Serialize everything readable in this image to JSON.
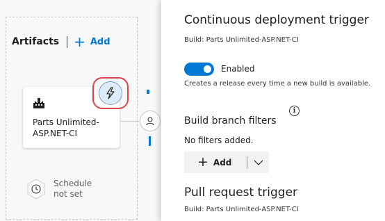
{
  "artifacts": {
    "title": "Artifacts",
    "add_label": "Add",
    "card": {
      "name": "Parts Unlimited-ASP.NET-CI",
      "icon": "build-pipeline-icon"
    },
    "trigger_icon": "lightning-trigger-icon",
    "approver_icon": "person-icon"
  },
  "schedule": {
    "label_line1": "Schedule",
    "label_line2": "not set",
    "icon": "clock-icon"
  },
  "panel": {
    "cd_trigger": {
      "title": "Continuous deployment trigger",
      "subtitle": "Build: Parts Unlimited-ASP.NET-CI",
      "toggle_label": "Enabled",
      "toggle_on": true,
      "description": "Creates a release every time a new build is available."
    },
    "branch_filters": {
      "title": "Build branch filters",
      "empty_text": "No filters added.",
      "add_label": "Add"
    },
    "pr_trigger": {
      "title": "Pull request trigger",
      "subtitle": "Build: Parts Unlimited-ASP.NET-CI"
    }
  },
  "colors": {
    "accent": "#0078d4",
    "highlight_ring": "#e0414a",
    "canvas_bg": "#f8f8f8",
    "panel_bg": "#ffffff"
  }
}
